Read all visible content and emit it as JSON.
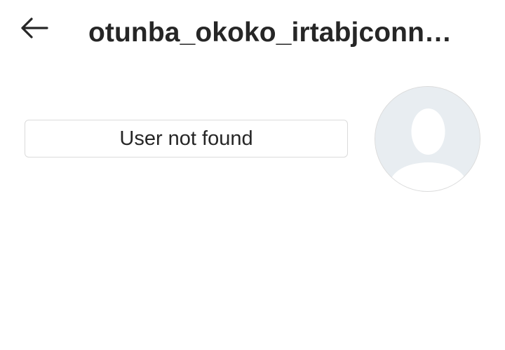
{
  "header": {
    "back_icon": "arrow-left-icon",
    "username": "otunba_okoko_irtabjconn…"
  },
  "profile": {
    "status_text": "User not found",
    "avatar_icon": "default-avatar-silhouette"
  },
  "colors": {
    "text": "#262626",
    "border": "#dbdbdb",
    "avatar_bg": "#e8edf1",
    "avatar_figure": "#ffffff"
  }
}
